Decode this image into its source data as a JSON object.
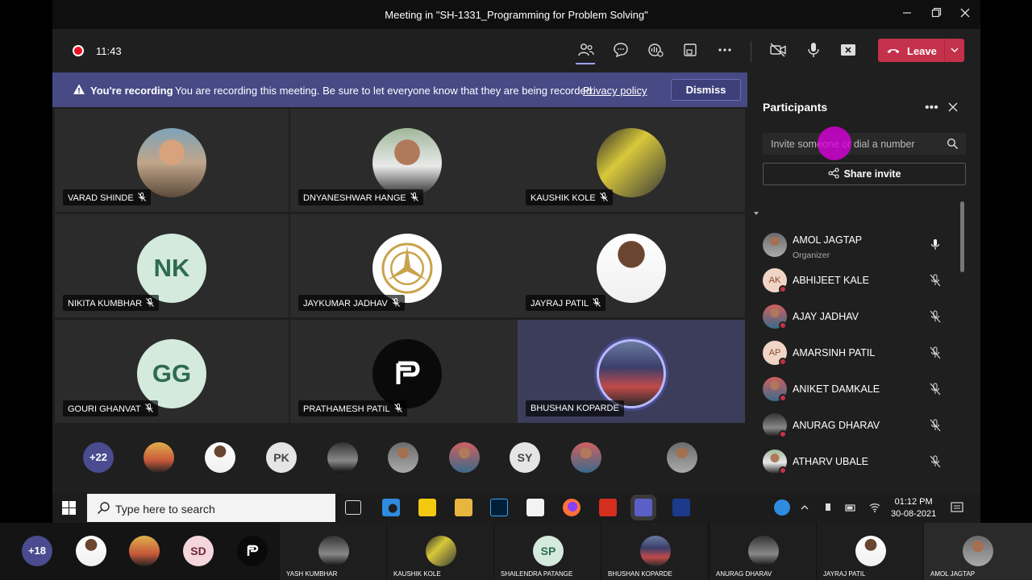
{
  "window": {
    "title": "Meeting in \"SH-1331_Programming for Problem Solving\"",
    "controls": [
      "minimize-icon",
      "maximize-icon",
      "close-icon"
    ]
  },
  "toolbar": {
    "timer": "11:43",
    "icons": [
      "people-icon",
      "chat-icon",
      "reactions-icon",
      "share-tray-icon",
      "more-icon",
      "camera-off-icon",
      "mic-icon",
      "share-screen-icon"
    ],
    "leave_label": "Leave",
    "leave_color": "#c4314b"
  },
  "banner": {
    "title": "You're recording",
    "message": "You are recording this meeting. Be sure to let everyone know that they are being recorded.",
    "link": "Privacy policy",
    "dismiss": "Dismiss",
    "color": "#474a85"
  },
  "tiles": [
    {
      "name": "VARAD SHINDE"
    },
    {
      "name": "DNYANESHWAR HANGE"
    },
    {
      "name": "KAUSHIK KOLE"
    },
    {
      "name": "NIKITA KUMBHAR",
      "initials": "NK"
    },
    {
      "name": "JAYKUMAR JADHAV"
    },
    {
      "name": "JAYRAJ PATIL"
    },
    {
      "name": "GOURI GHANVAT",
      "initials": "GG"
    },
    {
      "name": "PRATHAMESH PATIL"
    },
    {
      "name": "BHUSHAN KOPARDE"
    }
  ],
  "overflow": {
    "count": "+22",
    "initials": [
      "PK",
      "SY"
    ]
  },
  "participants": {
    "title": "Participants",
    "invite_placeholder": "Invite someone or dial a number",
    "share_invite": "Share invite",
    "list": [
      {
        "name": "AMOL JAGTAP",
        "role": "Organizer"
      },
      {
        "name": "ABHIJEET KALE",
        "initials": "AK"
      },
      {
        "name": "AJAY JADHAV"
      },
      {
        "name": "AMARSINH PATIL",
        "initials": "AP"
      },
      {
        "name": "ANIKET DAMKALE"
      },
      {
        "name": "ANURAG DHARAV"
      },
      {
        "name": "ATHARV UBALE"
      }
    ]
  },
  "taskbar": {
    "search_placeholder": "Type here to search",
    "time": "01:12 PM",
    "date": "30-08-2021"
  },
  "strip": {
    "count": "+18",
    "initials": [
      "SD",
      "SP"
    ],
    "tiles": [
      "YASH KUMBHAR",
      "KAUSHIK KOLE",
      "SHAILENDRA PATANGE",
      "BHUSHAN KOPARDE",
      "ANURAG DHARAV",
      "JAYRAJ PATIL",
      "AMOL JAGTAP"
    ]
  }
}
